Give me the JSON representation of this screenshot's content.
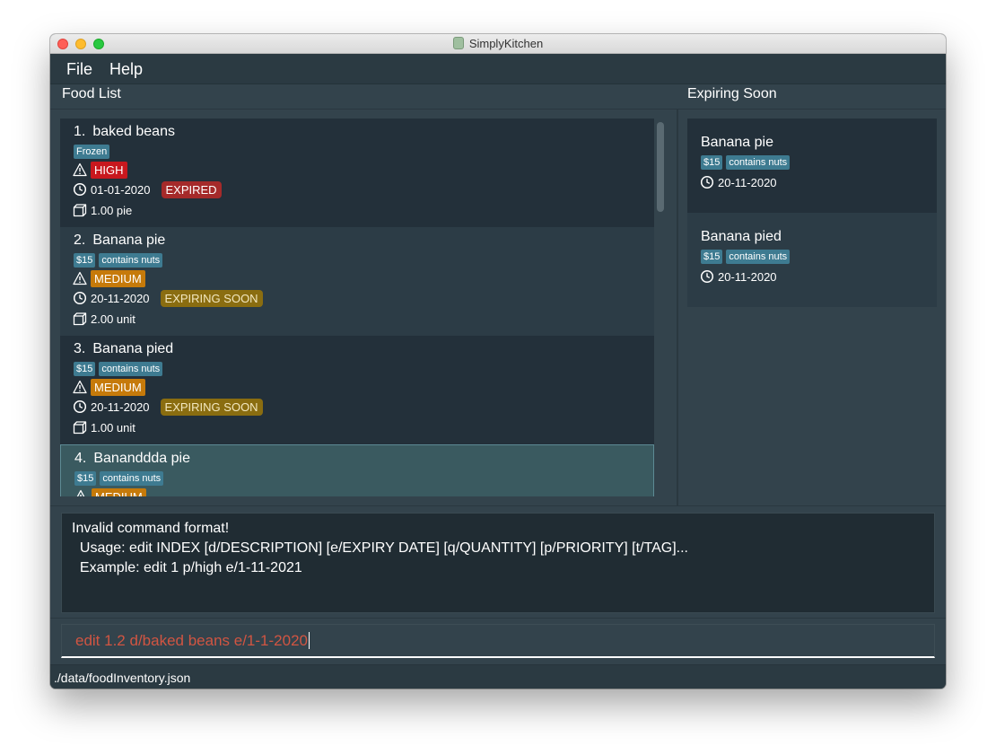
{
  "window": {
    "title": "SimplyKitchen"
  },
  "menu": {
    "file": "File",
    "help": "Help"
  },
  "food_list": {
    "header": "Food List",
    "items": [
      {
        "index": "1.",
        "name": "baked beans",
        "tags": [
          "Frozen"
        ],
        "priority": "HIGH",
        "expiry": "01-01-2020",
        "status": "EXPIRED",
        "quantity": "1.00 pie"
      },
      {
        "index": "2.",
        "name": "Banana pie",
        "tags": [
          "$15",
          "contains nuts"
        ],
        "priority": "MEDIUM",
        "expiry": "20-11-2020",
        "status": "EXPIRING SOON",
        "quantity": "2.00 unit"
      },
      {
        "index": "3.",
        "name": "Banana pied",
        "tags": [
          "$15",
          "contains nuts"
        ],
        "priority": "MEDIUM",
        "expiry": "20-11-2020",
        "status": "EXPIRING SOON",
        "quantity": "1.00 unit"
      },
      {
        "index": "4.",
        "name": "Bananddda pie",
        "tags": [
          "$15",
          "contains nuts"
        ],
        "priority": "MEDIUM"
      }
    ]
  },
  "expiring_soon": {
    "header": "Expiring Soon",
    "items": [
      {
        "name": "Banana pie",
        "tags": [
          "$15",
          "contains nuts"
        ],
        "expiry": "20-11-2020"
      },
      {
        "name": "Banana pied",
        "tags": [
          "$15",
          "contains nuts"
        ],
        "expiry": "20-11-2020"
      }
    ]
  },
  "result": {
    "lines": [
      "Invalid command format!",
      "  Usage: edit INDEX [d/DESCRIPTION] [e/EXPIRY DATE] [q/QUANTITY] [p/PRIORITY] [t/TAG]...",
      "  Example: edit 1 p/high e/1-11-2021"
    ]
  },
  "command": {
    "value": "edit 1.2 d/baked beans e/1-1-2020"
  },
  "status_bar": {
    "path": "./data/foodInventory.json"
  },
  "colors": {
    "background": "#33434c",
    "card_dark": "#23303a",
    "card_light": "#2c3c46",
    "tag": "#3e7b91",
    "high": "#c8181e",
    "medium": "#c67a0a",
    "expired": "#a52a2a",
    "expiring_soon": "#8a6d10",
    "command_error_text": "#d15542"
  },
  "icons": {
    "priority": "warning-icon",
    "expiry": "clock-icon",
    "quantity": "box-icon"
  }
}
